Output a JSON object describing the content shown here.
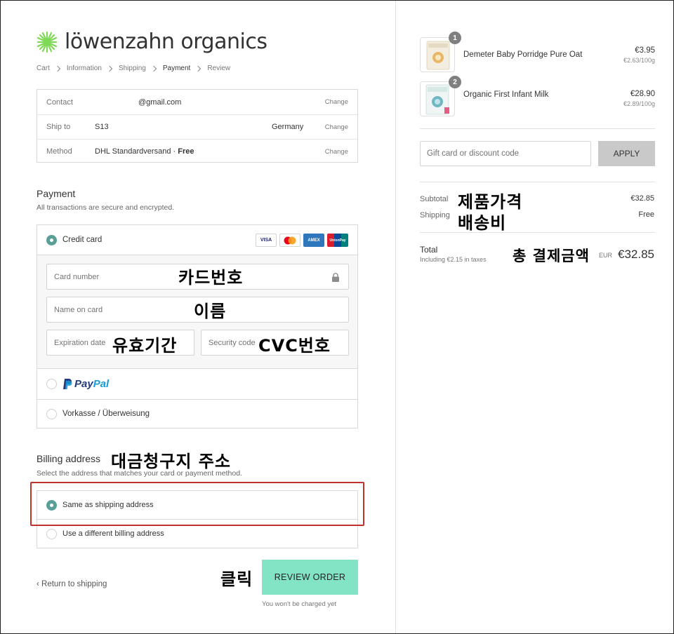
{
  "brand": {
    "name": "löwenzahn organics",
    "accent": "#7ed957"
  },
  "breadcrumb": {
    "cart": "Cart",
    "information": "Information",
    "shipping": "Shipping",
    "payment": "Payment",
    "review": "Review"
  },
  "review": {
    "contact": {
      "label": "Contact",
      "value": "@gmail.com",
      "change": "Change"
    },
    "ship_to": {
      "label": "Ship to",
      "value": "S13",
      "country": "Germany",
      "change": "Change"
    },
    "method": {
      "label": "Method",
      "value": "DHL Standardversand · ",
      "value_strong": "Free",
      "change": "Change"
    }
  },
  "payment": {
    "title": "Payment",
    "subtitle": "All transactions are secure and encrypted.",
    "credit_card_label": "Credit card",
    "card_brands": [
      "VISA",
      "MC",
      "AMEX",
      "UnionPay"
    ],
    "card_number_placeholder": "Card number",
    "name_placeholder": "Name on card",
    "expiry_placeholder": "Expiration date",
    "cvc_placeholder": "Security code",
    "paypal_pay": "Pay",
    "paypal_pal": "Pal",
    "vorkasse_label": "Vorkasse / Überweisung",
    "selected": "credit-card"
  },
  "billing": {
    "title": "Billing address",
    "subtitle": "Select the address that matches your card or payment method.",
    "same_label": "Same as shipping address",
    "different_label": "Use a different billing address",
    "selected": "same"
  },
  "actions": {
    "return_label": "Return to shipping",
    "review_button": "REVIEW ORDER",
    "charged_note": "You won't be charged yet"
  },
  "annotations": {
    "card_number": "카드번호",
    "name": "이름",
    "expiry": "유효기간",
    "cvc": "CVC번호",
    "billing": "대금청구지 주소",
    "click": "클릭",
    "subtotal": "제품가격",
    "shipping": "배송비",
    "total": "총 결제금액"
  },
  "order": {
    "items": [
      {
        "qty": "1",
        "name": "Demeter Baby Porridge Pure Oat",
        "price": "€3.95",
        "unit_price": "€2.63/100g"
      },
      {
        "qty": "2",
        "name": "Organic First Infant Milk",
        "price": "€28.90",
        "unit_price": "€2.89/100g"
      }
    ],
    "gift_placeholder": "Gift card or discount code",
    "apply_label": "APPLY",
    "subtotal_label": "Subtotal",
    "subtotal_value": "€32.85",
    "shipping_label": "Shipping",
    "shipping_value": "Free",
    "total_label": "Total",
    "tax_note": "Including €2.15 in taxes",
    "currency": "EUR",
    "total_value": "€32.85"
  },
  "colors": {
    "review_button": "#82e3c5",
    "radio_selected": "#5a9e98",
    "highlight_box": "#c4302b",
    "apply_button": "#c9c9c9"
  }
}
